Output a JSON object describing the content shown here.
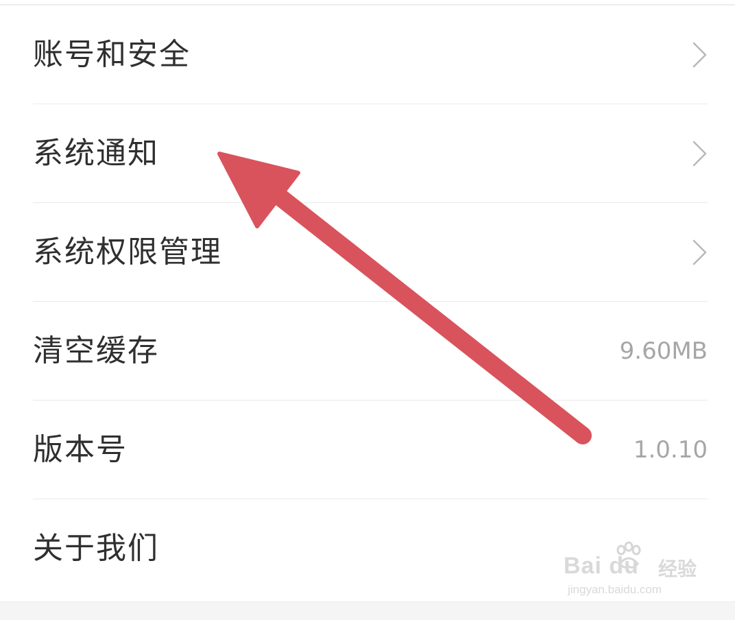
{
  "settings": {
    "items": [
      {
        "label": "账号和安全",
        "value": "",
        "chevron": true
      },
      {
        "label": "系统通知",
        "value": "",
        "chevron": true
      },
      {
        "label": "系统权限管理",
        "value": "",
        "chevron": true
      },
      {
        "label": "清空缓存",
        "value": "9.60MB",
        "chevron": false
      },
      {
        "label": "版本号",
        "value": "1.0.10",
        "chevron": false
      },
      {
        "label": "关于我们",
        "value": "",
        "chevron": false
      }
    ]
  },
  "icons": {
    "chevron": "chevron-right-icon",
    "annotation": "red-arrow"
  },
  "colors": {
    "text_primary": "#2f2f2f",
    "text_secondary": "#a6a6a6",
    "divider": "#e9e9e9",
    "arrow": "#d9535c"
  },
  "watermark": {
    "logo": "Bai du",
    "product": "经验",
    "url": "jingyan.baidu.com"
  }
}
